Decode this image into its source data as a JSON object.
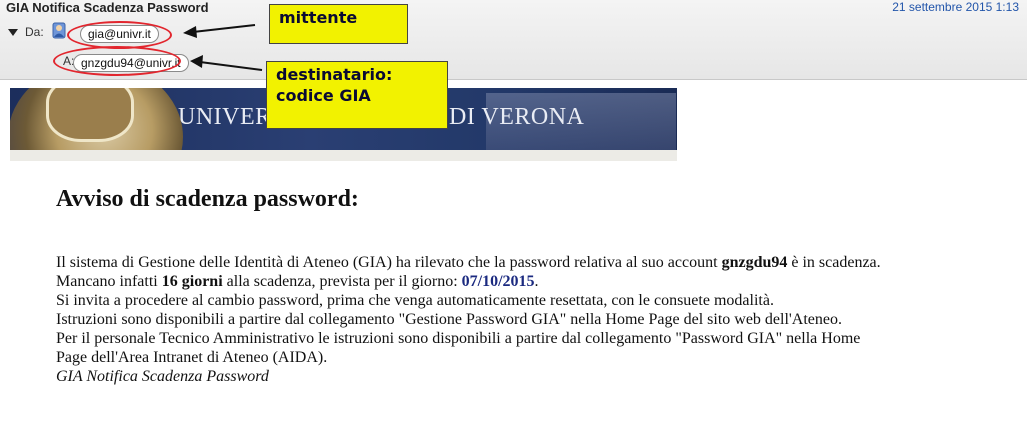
{
  "header": {
    "subject": "GIA Notifica Scadenza Password",
    "date": "21 settembre 2015 1:13",
    "from_label": "Da:",
    "from_address": "gia@univr.it",
    "to_label": "A:",
    "to_address": "gnzgdu94@univr.it"
  },
  "annotations": {
    "sender_callout": "mittente",
    "recipient_callout_line1": "destinatario:",
    "recipient_callout_line2": "codice GIA",
    "callout_color": "#f2f200",
    "ring_color": "#e2262e"
  },
  "banner": {
    "text_left": "UNIVERS",
    "text_right": "DI VERONA"
  },
  "message": {
    "title": "Avviso di scadenza password:",
    "line1_a": "Il sistema di Gestione delle Identità di Ateneo (GIA) ha rilevato che la password relativa al suo account ",
    "line1_account": "gnzgdu94",
    "line1_b": " è in scadenza.",
    "line2_a": "Mancano infatti ",
    "line2_days": "16 giorni",
    "line2_b": " alla scadenza, prevista per il giorno: ",
    "line2_date": "07/10/2015",
    "line2_c": ".",
    "line3": "Si invita a procedere al cambio password, prima che venga automaticamente resettata, con le consuete modalità.",
    "line4": "Istruzioni sono disponibili a partire dal collegamento \"Gestione Password GIA\" nella Home Page del sito web dell'Ateneo.",
    "line5": "Per il personale Tecnico Amministrativo le istruzioni sono disponibili a partire dal collegamento \"Password GIA\" nella Home",
    "line6": "Page dell'Area Intranet di Ateneo (AIDA).",
    "signature": "GIA Notifica Scadenza Password"
  }
}
